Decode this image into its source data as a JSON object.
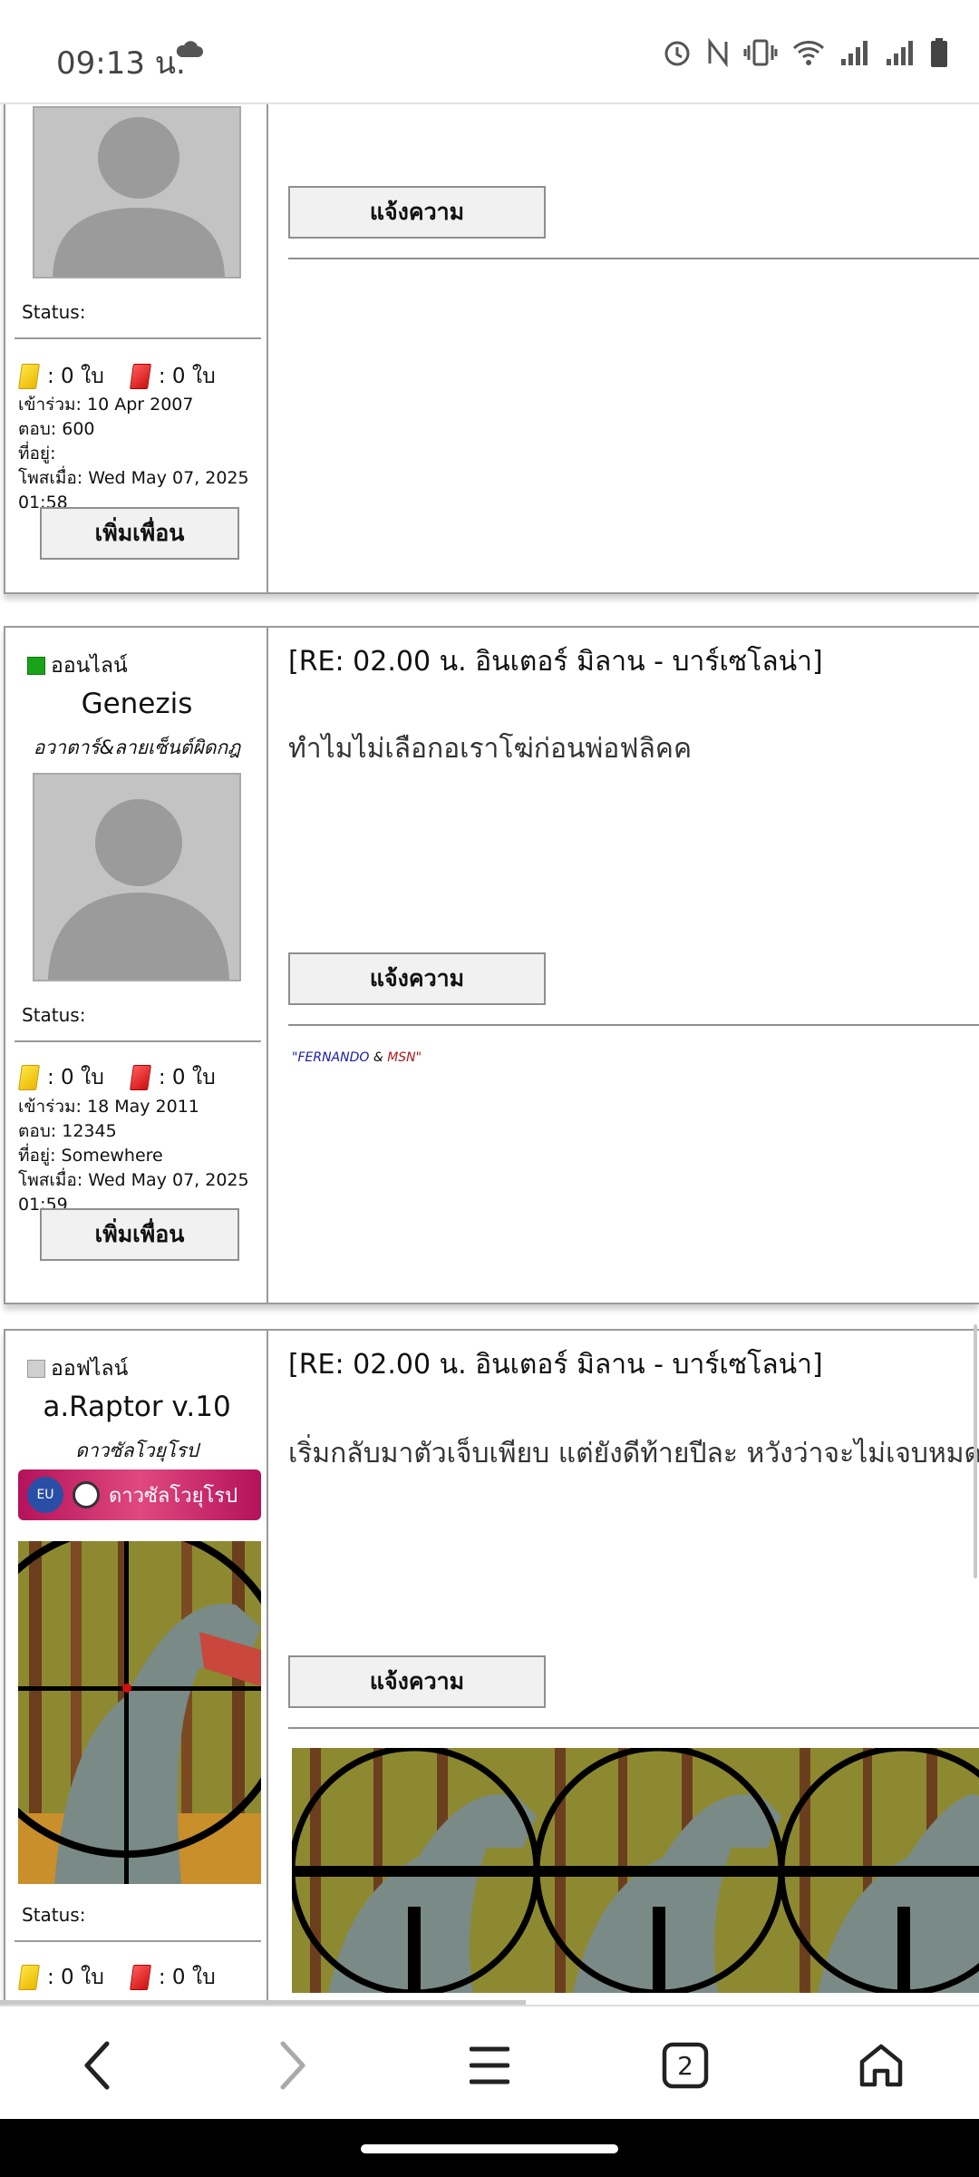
{
  "status_bar": {
    "time": "09:13 น."
  },
  "posts": [
    {
      "status_label": "Status:",
      "yellow_cards": ": 0 ใบ",
      "red_cards": ": 0 ใบ",
      "joined": "เข้าร่วม: 10 Apr 2007",
      "replies": "ตอบ: 600",
      "location": "ที่อยู่:",
      "posted": "โพสเมื่อ: Wed May 07, 2025 01:58",
      "add_friend": "เพิ่มเพื่อน",
      "report": "แจ้งความ"
    },
    {
      "online": "ออนไลน์",
      "username": "Genezis",
      "user_title": "อวาตาร์&ลายเซ็นต์ผิดกฎ",
      "status_label": "Status:",
      "yellow_cards": ": 0 ใบ",
      "red_cards": ": 0 ใบ",
      "joined": "เข้าร่วม: 18 May 2011",
      "replies": "ตอบ: 12345",
      "location": "ที่อยู่: Somewhere",
      "posted": "โพสเมื่อ: Wed May 07, 2025 01:59",
      "add_friend": "เพิ่มเพื่อน",
      "subject": "[RE: 02.00 น. อินเตอร์ มิลาน - บาร์เซโลน่า]",
      "body": "ทำไมไม่เลือกอเราโฆ่ก่อนพ่อฟลิคค",
      "report": "แจ้งความ",
      "sig_fernando": "\"FERNANDO",
      "sig_amp": " & ",
      "sig_msn": "MSN\""
    },
    {
      "online": "ออฟไลน์",
      "username": "a.Raptor v.10",
      "user_title": "ดาวซัลโวยุโรป",
      "banner_eu": "EU",
      "banner_text": "ดาวซัลโวยุโรป",
      "status_label": "Status:",
      "yellow_cards": ": 0 ใบ",
      "red_cards": ": 0 ใบ",
      "subject": "[RE: 02.00 น. อินเตอร์ มิลาน - บาร์เซโลน่า]",
      "body": "เริ่มกลับมาตัวเจ็บเพียบ แต่ยังดีท้ายปีละ หวังว่าจะไม่เจบหมด",
      "report": "แจ้งความ"
    }
  ],
  "navbar": {
    "tab_count": "2"
  },
  "icons": [
    "cloud-icon",
    "alarm-icon",
    "nfc-icon",
    "vibrate-icon",
    "wifi-icon",
    "signal-icon",
    "battery-icon",
    "back-icon",
    "forward-icon",
    "menu-icon",
    "tabs-icon",
    "home-icon"
  ]
}
